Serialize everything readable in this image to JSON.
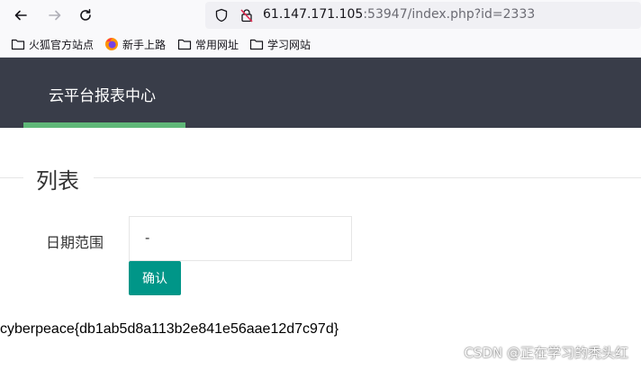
{
  "browser": {
    "url_host": "61.147.171.105",
    "url_rest": ":53947/index.php?id=2333",
    "bookmarks": [
      {
        "label": "火狐官方站点",
        "icon": "folder-icon"
      },
      {
        "label": "新手上路",
        "icon": "firefox-icon"
      },
      {
        "label": "常用网址",
        "icon": "folder-icon"
      },
      {
        "label": "学习网站",
        "icon": "folder-icon"
      }
    ]
  },
  "header": {
    "brand": "云平台报表中心",
    "bg_color": "#393d49",
    "active_color": "#5fb878"
  },
  "main": {
    "legend": "列表",
    "date_label": "日期范围",
    "date_value": "-",
    "confirm_label": "确认",
    "confirm_color": "#009688",
    "output": "cyberpeace{db1ab5d8a113b2e841e56aae12d7c97d}"
  },
  "watermark": "CSDN @正在学习的秃头红"
}
